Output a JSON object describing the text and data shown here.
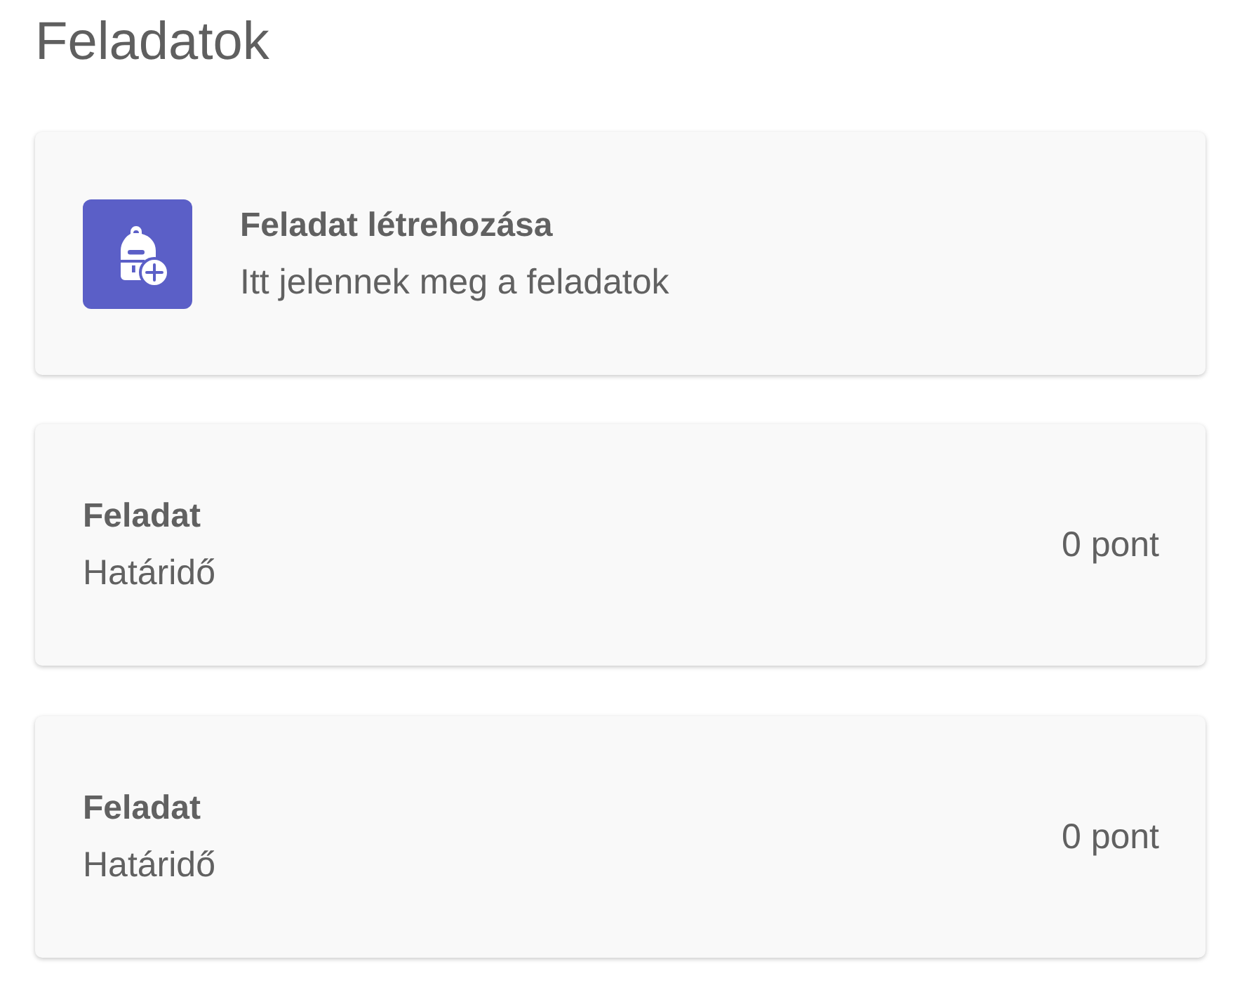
{
  "page": {
    "title": "Feladatok"
  },
  "create_card": {
    "title": "Feladat létrehozása",
    "subtitle": "Itt jelennek meg a feladatok"
  },
  "assignments": [
    {
      "title": "Feladat",
      "due": "Határidő",
      "points": "0 pont"
    },
    {
      "title": "Feladat",
      "due": "Határidő",
      "points": "0 pont"
    }
  ]
}
